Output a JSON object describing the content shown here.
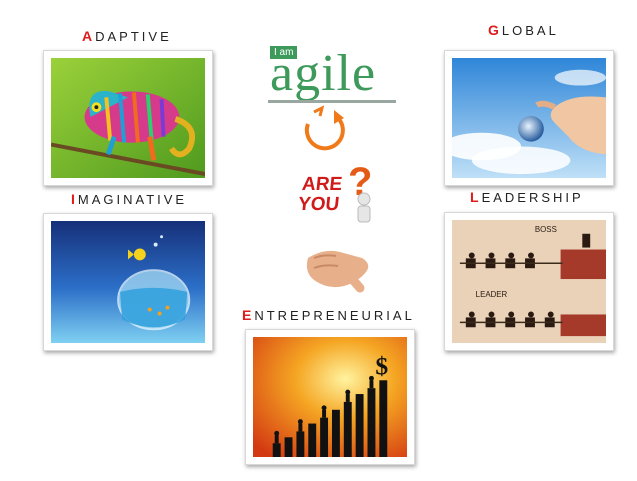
{
  "words": {
    "adaptive": {
      "initial": "A",
      "rest": "DAPTIVE"
    },
    "global": {
      "initial": "G",
      "rest": "LOBAL"
    },
    "imaginative": {
      "initial": "I",
      "rest": "MAGINATIVE"
    },
    "leadership": {
      "initial": "L",
      "rest": "EADERSHIP"
    },
    "entrepreneurial": {
      "initial": "E",
      "rest": "NTREPRENEURIAL"
    }
  },
  "logo": {
    "badge": "I am",
    "word": "agile"
  },
  "question": {
    "line1": "ARE",
    "line2": "YOU",
    "mark": "?"
  },
  "leadership_image": {
    "boss": "BOSS",
    "leader": "LEADER"
  },
  "entrepreneur_image": {
    "symbol": "$"
  },
  "colors": {
    "accent_red": "#e01b1b",
    "logo_green": "#3d9a5b",
    "logo_orange": "#f07a1a"
  }
}
